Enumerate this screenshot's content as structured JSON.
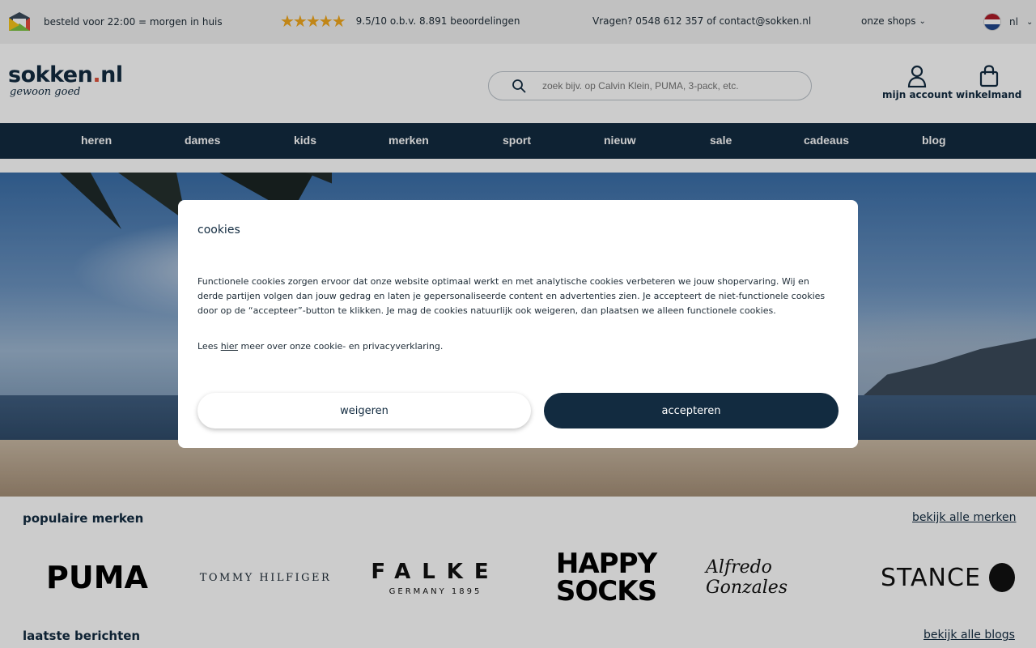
{
  "topbar": {
    "delivery": "besteld voor 22:00 = morgen in huis",
    "rating_stars": "★★★★★",
    "rating": "9.5/10 o.b.v. 8.891 beoordelingen",
    "contact": "Vragen? 0548 612 357 of contact@sokken.nl",
    "shops": "onze shops",
    "lang": "nl"
  },
  "header": {
    "logo_main": "sokken",
    "logo_dot": ".",
    "logo_tld": "nl",
    "logo_sub": "gewoon goed",
    "search_placeholder": "zoek bijv. op Calvin Klein, PUMA, 3-pack, etc.",
    "account": "mijn account",
    "cart": "winkelmand"
  },
  "nav": [
    "heren",
    "dames",
    "kids",
    "merken",
    "sport",
    "nieuw",
    "sale",
    "cadeaus",
    "blog"
  ],
  "cookie": {
    "title": "cookies",
    "text": "Functionele cookies zorgen ervoor dat onze website optimaal werkt en met analytische cookies verbeteren we jouw shopervaring. Wij en derde partijen volgen dan jouw gedrag en laten je gepersonaliseerde content en advertenties zien. Je accepteert de niet-functionele cookies door op de “accepteer”-button te klikken. Je mag de cookies natuurlijk ook weigeren, dan plaatsen we alleen functionele cookies.",
    "more_prefix": "Lees ",
    "more_link": "hier",
    "more_suffix": " meer over onze cookie- en privacyverklaring.",
    "refuse": "weigeren",
    "accept": "accepteren"
  },
  "brands": {
    "title": "populaire merken",
    "link": "bekijk alle merken",
    "puma": "PUMA",
    "tommy": "TOMMY HILFIGER",
    "falke_big": "FALKE",
    "falke_small": "GERMANY 1895",
    "happy_1": "HAPPY",
    "happy_2": "SOCKS",
    "alfredo": "Alfredo Gonzales",
    "stance": "STANCE"
  },
  "posts": {
    "title": "laatste berichten",
    "link": "bekijk alle blogs"
  },
  "colors": {
    "navy": "#122b40",
    "star": "#f2a81d",
    "logo_dot": "#e0533c"
  }
}
